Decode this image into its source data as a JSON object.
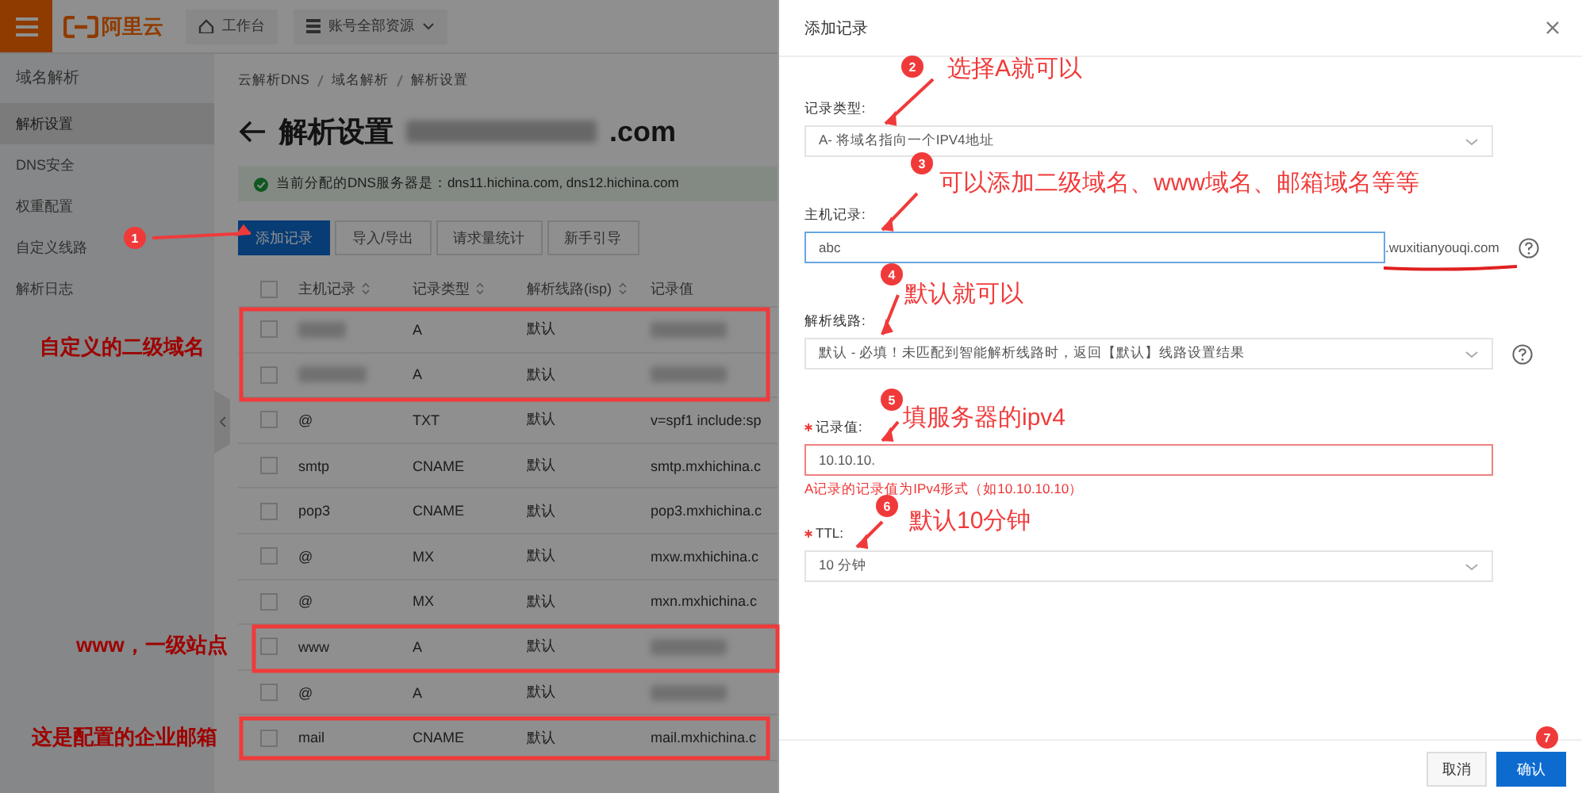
{
  "topbar": {
    "logo": "阿里云",
    "workbench": "工作台",
    "resources": "账号全部资源"
  },
  "sidebar": {
    "title": "域名解析",
    "items": [
      {
        "label": "解析设置",
        "selected": true
      },
      {
        "label": "DNS安全",
        "selected": false
      },
      {
        "label": "权重配置",
        "selected": false
      },
      {
        "label": "自定义线路",
        "selected": false
      },
      {
        "label": "解析日志",
        "selected": false
      }
    ]
  },
  "breadcrumb": [
    "云解析DNS",
    "域名解析",
    "解析设置"
  ],
  "page": {
    "title": "解析设置",
    "domain_suffix": ".com",
    "notice": "当前分配的DNS服务器是：dns11.hichina.com, dns12.hichina.com"
  },
  "toolbar": [
    {
      "label": "添加记录",
      "kind": "primary"
    },
    {
      "label": "导入/导出",
      "kind": "default"
    },
    {
      "label": "请求量统计",
      "kind": "default"
    },
    {
      "label": "新手引导",
      "kind": "default"
    }
  ],
  "table": {
    "header_checked": false,
    "columns": [
      "主机记录",
      "记录类型",
      "解析线路(isp)",
      "记录值"
    ],
    "rows": [
      {
        "checked": false,
        "type": "A",
        "line": "默认"
      },
      {
        "checked": false,
        "type": "A",
        "line": "默认"
      },
      {
        "checked": false,
        "host": "@",
        "type": "TXT",
        "line": "默认",
        "value": "v=spf1 include:sp"
      },
      {
        "checked": false,
        "host": "smtp",
        "type": "CNAME",
        "line": "默认",
        "value": "smtp.mxhichina.c"
      },
      {
        "checked": false,
        "host": "pop3",
        "type": "CNAME",
        "line": "默认",
        "value": "pop3.mxhichina.c"
      },
      {
        "checked": false,
        "host": "@",
        "type": "MX",
        "line": "默认",
        "value": "mxw.mxhichina.c"
      },
      {
        "checked": false,
        "host": "@",
        "type": "MX",
        "line": "默认",
        "value": "mxn.mxhichina.c"
      },
      {
        "checked": false,
        "host": "www",
        "type": "A",
        "line": "默认"
      },
      {
        "checked": false,
        "host": "@",
        "type": "A",
        "line": "默认"
      },
      {
        "checked": false,
        "host": "mail",
        "type": "CNAME",
        "line": "默认",
        "value": "mail.mxhichina.c"
      }
    ]
  },
  "drawer": {
    "title": "添加记录",
    "fields": [
      {
        "kind": "select",
        "label": "记录类型:",
        "required": false,
        "error": false,
        "value": "A- 将域名指向一个IPV4地址"
      },
      {
        "kind": "input",
        "label": "主机记录:",
        "required": false,
        "error": false,
        "value": "abc",
        "suffix": ".wuxitianyouqi.com",
        "help": true
      },
      {
        "kind": "select",
        "label": "解析线路:",
        "required": false,
        "error": false,
        "value": "默认 - 必填！未匹配到智能解析线路时，返回【默认】线路设置结果",
        "help": true
      },
      {
        "kind": "input",
        "label": "记录值:",
        "required": true,
        "error": true,
        "value": "10.10.10.",
        "message": "A记录的记录值为IPv4形式（如10.10.10.10）"
      },
      {
        "kind": "select",
        "label": "TTL:",
        "required": true,
        "error": false,
        "value": "10 分钟"
      }
    ],
    "buttons": [
      {
        "label": "取消",
        "kind": "default"
      },
      {
        "label": "确认",
        "kind": "primary"
      }
    ]
  },
  "annotations": [
    {
      "badge": "1"
    },
    {
      "badge": "2",
      "note": "选择A就可以"
    },
    {
      "badge": "3",
      "note": "可以添加二级域名、www域名、邮箱域名等等"
    },
    {
      "badge": "4",
      "note": "默认就可以"
    },
    {
      "badge": "5",
      "note": "填服务器的ipv4"
    },
    {
      "badge": "6",
      "note": "默认10分钟"
    },
    {
      "badge": "7"
    }
  ],
  "side_notes": [
    "自定义的二级域名",
    "www，一级站点",
    "这是配置的企业邮箱"
  ]
}
